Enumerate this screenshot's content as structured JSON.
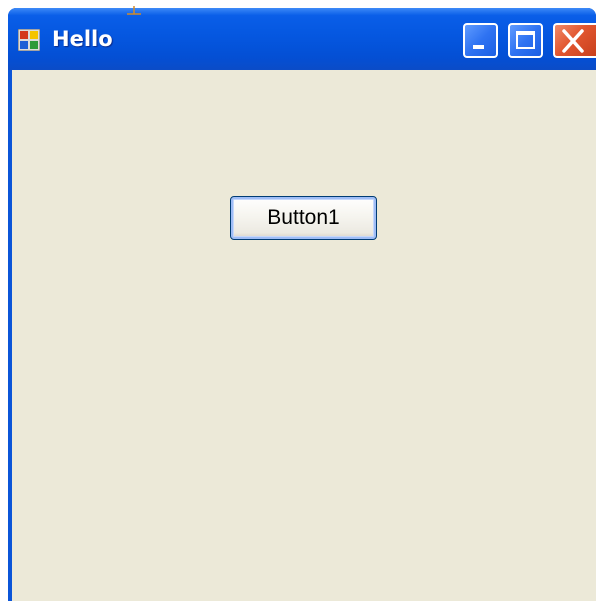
{
  "window": {
    "title": "Hello",
    "titlebar_color": "#0b55d8",
    "client_background": "#ece9d8",
    "icons": {
      "app": "app-window-icon",
      "minimize": "minimize-icon",
      "maximize": "maximize-icon",
      "close": "close-icon"
    }
  },
  "form": {
    "button1_label": "Button1"
  }
}
